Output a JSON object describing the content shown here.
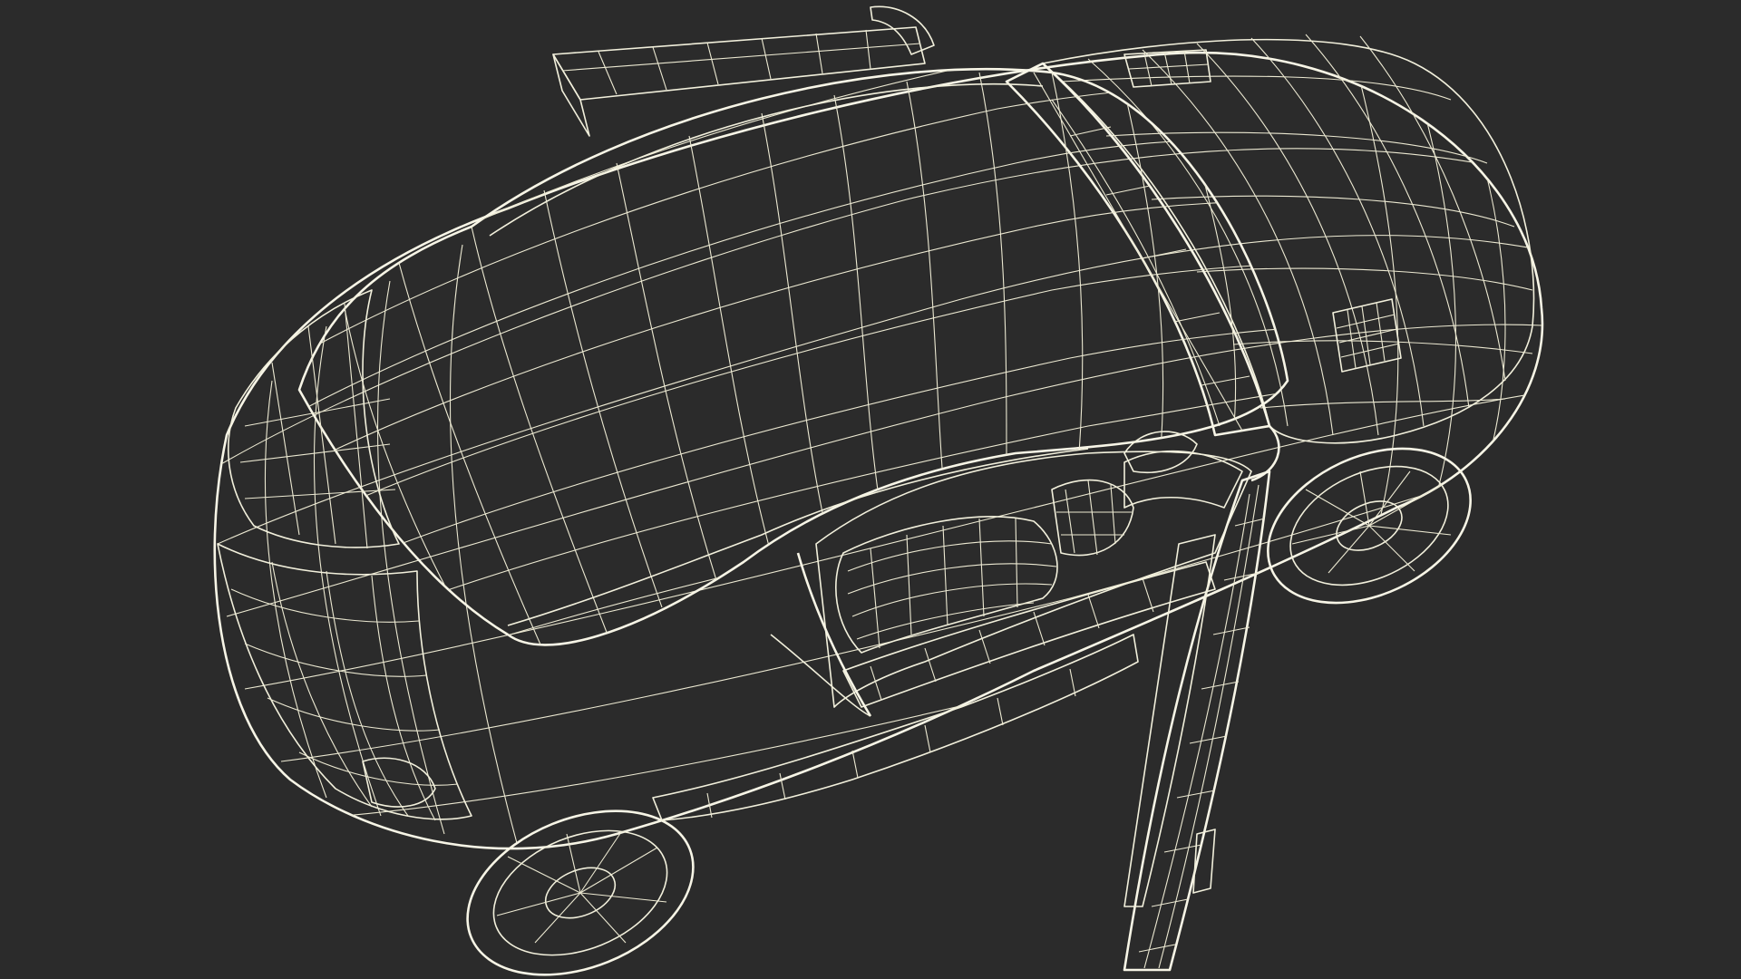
{
  "scene": {
    "background_color": "#2b2b2b",
    "surface_color": "#7e7f73",
    "surface_dark_color": "#5f6057",
    "shadow_color": "#2f302b",
    "wire_color": "#f2f0dc"
  }
}
